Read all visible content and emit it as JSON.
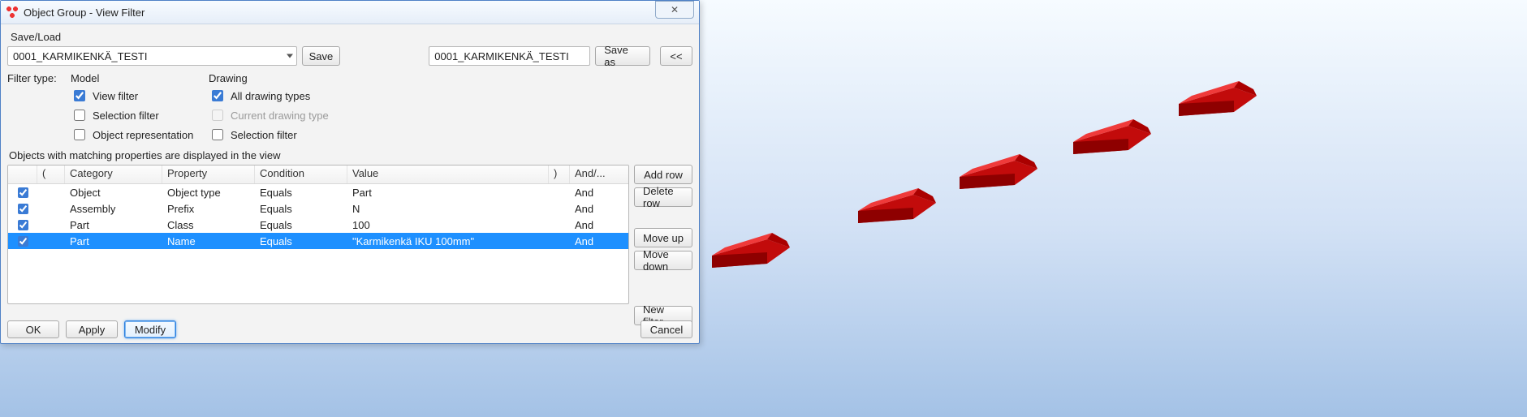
{
  "window": {
    "title": "Object Group - View Filter"
  },
  "saveload": {
    "label": "Save/Load",
    "combo_value": "0001_KARMIKENKÄ_TESTI",
    "save_btn": "Save",
    "name_value": "0001_KARMIKENKÄ_TESTI",
    "saveas_btn": "Save as",
    "collapse_btn": "<<"
  },
  "filter_type": {
    "label": "Filter type:",
    "model_header": "Model",
    "drawing_header": "Drawing",
    "view_filter": "View filter",
    "selection_filter_model": "Selection filter",
    "object_representation": "Object representation",
    "all_drawing_types": "All drawing types",
    "current_drawing_type": "Current drawing type",
    "selection_filter_drawing": "Selection filter"
  },
  "objects_label": "Objects with matching properties are displayed in the view",
  "table": {
    "headers": {
      "paren_open": "(",
      "category": "Category",
      "property": "Property",
      "condition": "Condition",
      "value": "Value",
      "paren_close": ")",
      "andor": "And/..."
    },
    "rows": [
      {
        "checked": true,
        "category": "Object",
        "property": "Object type",
        "condition": "Equals",
        "value": "Part",
        "andor": "And"
      },
      {
        "checked": true,
        "category": "Assembly",
        "property": "Prefix",
        "condition": "Equals",
        "value": "N",
        "andor": "And"
      },
      {
        "checked": true,
        "category": "Part",
        "property": "Class",
        "condition": "Equals",
        "value": "100",
        "andor": "And"
      },
      {
        "checked": true,
        "category": "Part",
        "property": "Name",
        "condition": "Equals",
        "value": "\"Karmikenkä IKU 100mm\"",
        "andor": "And",
        "selected": true
      }
    ]
  },
  "side": {
    "add_row": "Add row",
    "delete_row": "Delete row",
    "move_up": "Move up",
    "move_down": "Move down",
    "new_filter": "New filter"
  },
  "bottom": {
    "ok": "OK",
    "apply": "Apply",
    "modify": "Modify",
    "cancel": "Cancel"
  },
  "colors": {
    "selection": "#1e90ff",
    "part_red": "#d30b0b"
  }
}
